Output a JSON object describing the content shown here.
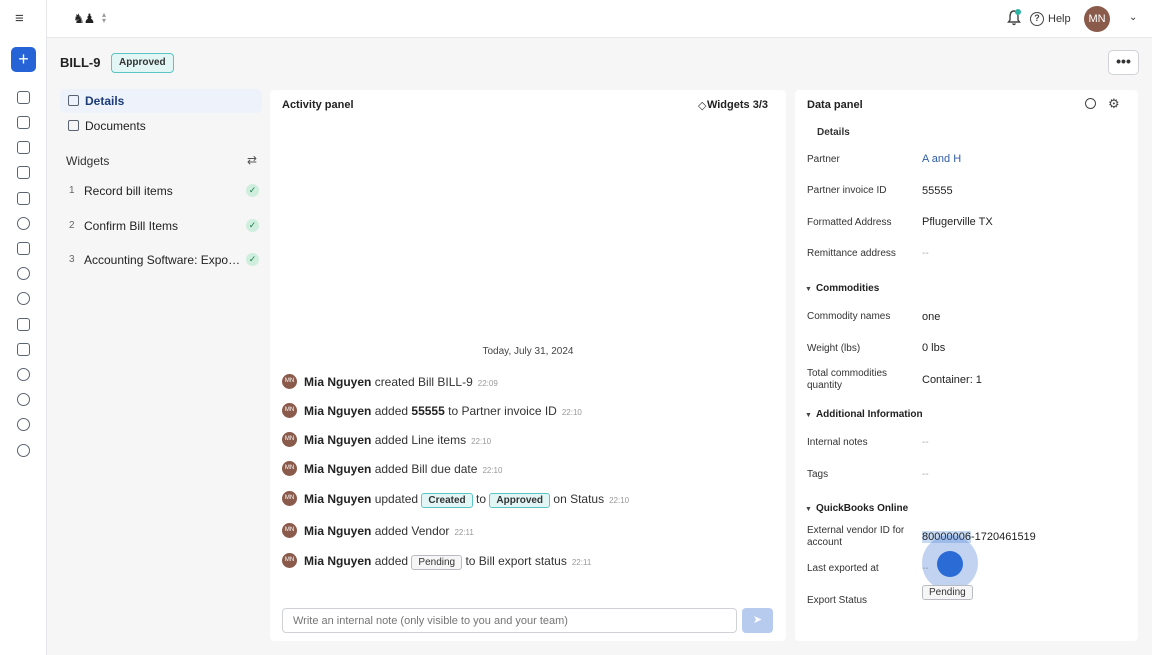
{
  "app": {
    "title": "BILL-9",
    "status": "Approved",
    "more_label": "•••",
    "help_label": "Help",
    "user_initials": "MN"
  },
  "left_nav": {
    "items": [
      {
        "label": "Details",
        "active": true
      },
      {
        "label": "Documents",
        "active": false
      }
    ],
    "widgets_heading": "Widgets",
    "widgets": [
      {
        "num": "1",
        "label": "Record bill items",
        "done": true
      },
      {
        "num": "2",
        "label": "Confirm Bill Items",
        "done": true
      },
      {
        "num": "3",
        "label": "Accounting Software: Export bill",
        "done": true
      }
    ]
  },
  "activity": {
    "title": "Activity panel",
    "widgets_count": "Widgets 3/3",
    "date": "Today, July 31, 2024",
    "entries": [
      {
        "user": "Mia Nguyen",
        "pre": "created Bill BILL-9",
        "bold": "",
        "post": "",
        "time": "22:09"
      },
      {
        "user": "Mia Nguyen",
        "pre": "added",
        "bold": "55555",
        "post": "to Partner invoice ID",
        "time": "22:10"
      },
      {
        "user": "Mia Nguyen",
        "pre": "added Line items",
        "bold": "",
        "post": "",
        "time": "22:10"
      },
      {
        "user": "Mia Nguyen",
        "pre": "added Bill due date",
        "bold": "",
        "post": "",
        "time": "22:10"
      },
      {
        "user": "Mia Nguyen",
        "pre": "updated",
        "tag1": "Created",
        "mid": "to",
        "tag2": "Approved",
        "post": "on Status",
        "time": "22:10"
      },
      {
        "user": "Mia Nguyen",
        "pre": "added Vendor",
        "bold": "",
        "post": "",
        "time": "22:11"
      },
      {
        "user": "Mia Nguyen",
        "pre": "added",
        "tag": "Pending",
        "post": "to Bill export status",
        "time": "22:11"
      }
    ],
    "note_placeholder": "Write an internal note (only visible to you and your team)"
  },
  "data_panel": {
    "title": "Data panel",
    "cut_section": "Details",
    "details": [
      {
        "label": "Partner",
        "value": "A and H",
        "link": true
      },
      {
        "label": "Partner invoice ID",
        "value": "55555"
      },
      {
        "label": "Formatted Address",
        "value": "Pflugerville TX"
      },
      {
        "label": "Remittance address",
        "value": "--"
      }
    ],
    "commodities_heading": "Commodities",
    "commodities": [
      {
        "label": "Commodity names",
        "value": "one"
      },
      {
        "label": "Weight (lbs)",
        "value": "0 lbs"
      },
      {
        "label": "Total commodities quantity",
        "value": "Container: 1"
      }
    ],
    "additional_heading": "Additional Information",
    "additional": [
      {
        "label": "Internal notes",
        "value": "--"
      },
      {
        "label": "Tags",
        "value": "--"
      }
    ],
    "qbo_heading": "QuickBooks Online",
    "qbo": {
      "vendor_label": "External vendor ID for account",
      "vendor_value_selected": "80000006",
      "vendor_value_rest": "-1720461519",
      "last_exported_label": "Last exported at",
      "last_exported_value": "--",
      "export_status_label": "Export Status",
      "export_status_value": "Pending"
    }
  }
}
